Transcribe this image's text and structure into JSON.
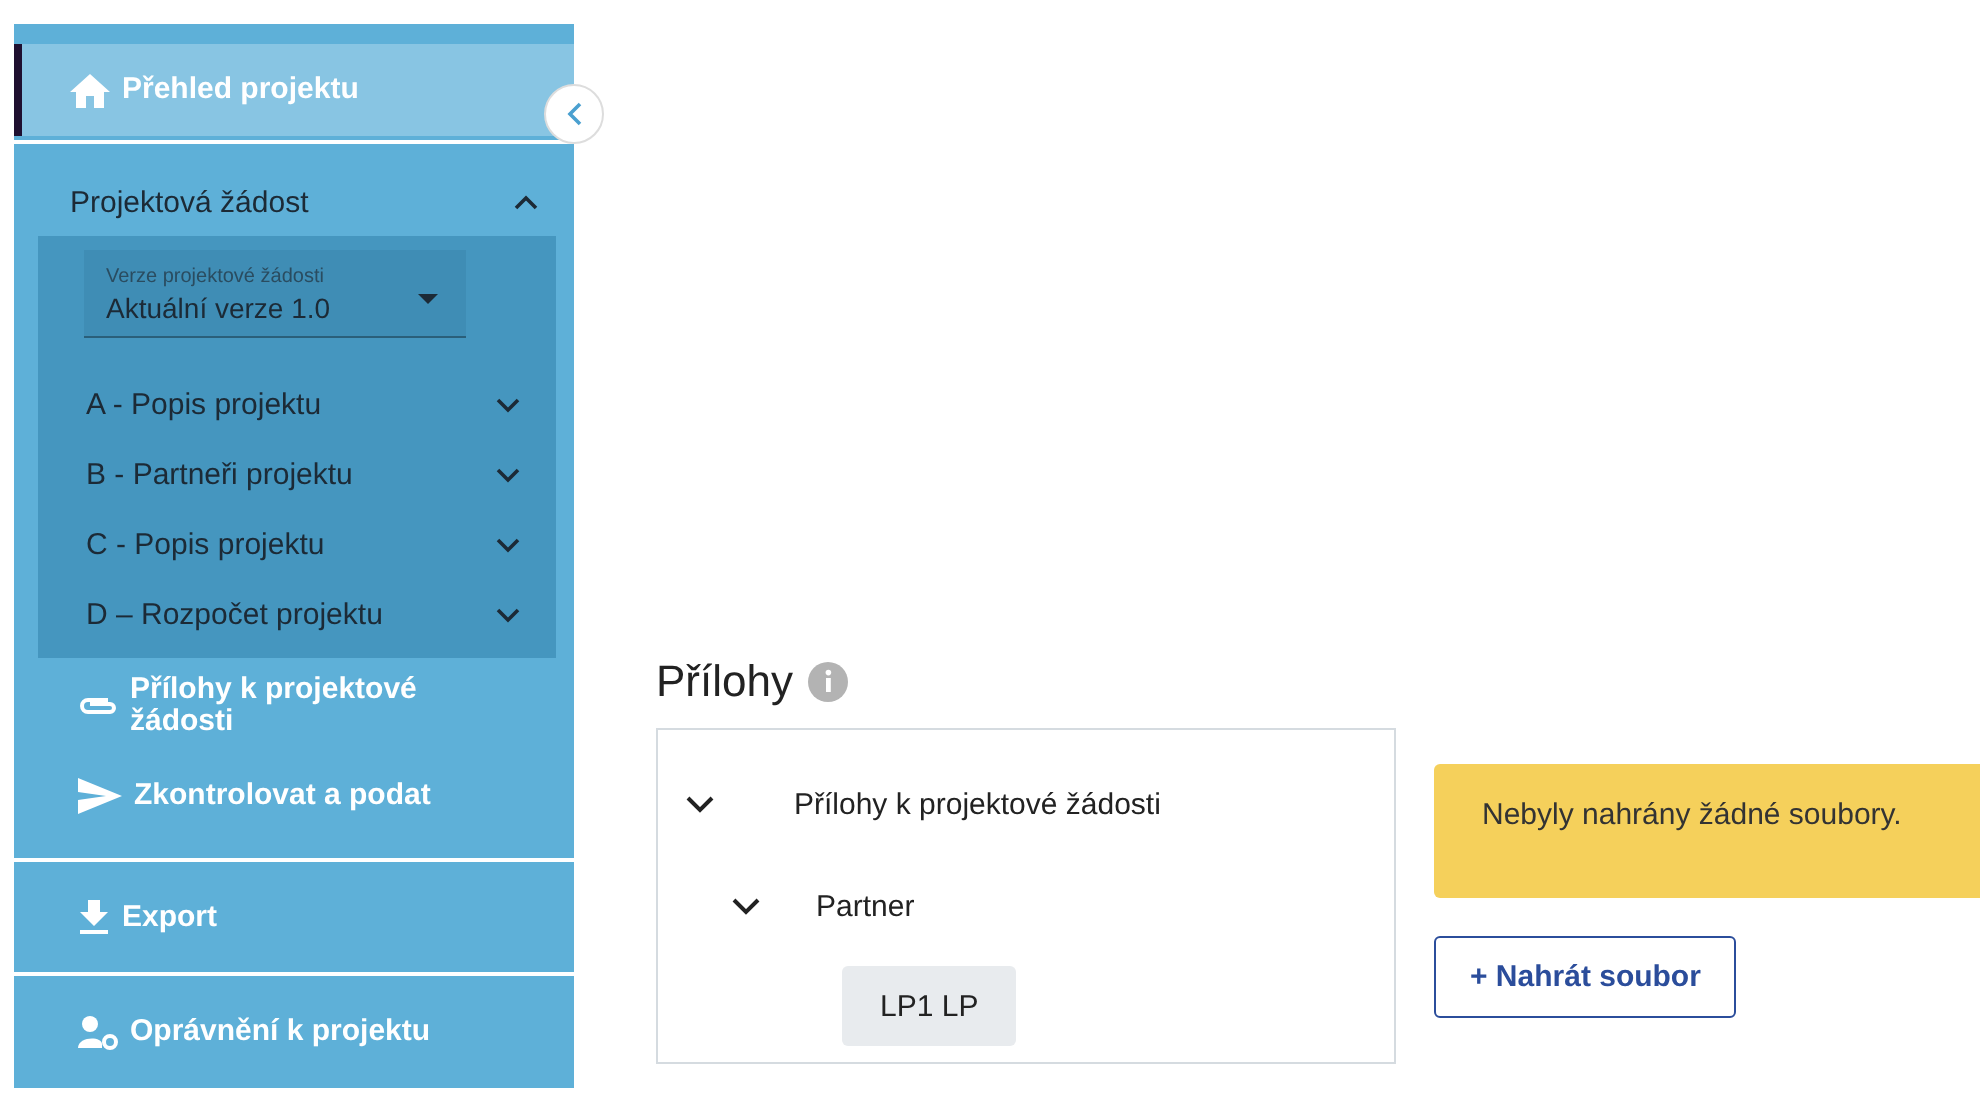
{
  "sidebar": {
    "items": [
      {
        "kind": "home",
        "label": "Přehled projektu",
        "selected": true
      },
      {
        "kind": "section",
        "label": "Projektová žádost",
        "expanded": true,
        "version_select": {
          "label": "Verze projektové žádosti",
          "value": "Aktuální verze 1.0"
        },
        "children": [
          {
            "label": "A - Popis projektu",
            "expanded": false
          },
          {
            "label": "B - Partneři projektu",
            "expanded": false
          },
          {
            "label": "C - Popis projektu",
            "expanded": false
          },
          {
            "label": "D – Rozpočet projektu",
            "expanded": false
          }
        ]
      },
      {
        "kind": "attachment",
        "label": "Přílohy k projektové žádosti",
        "selected": false
      },
      {
        "kind": "send",
        "label": "Zkontrolovat a podat",
        "selected": false
      },
      {
        "kind": "export",
        "label": "Export",
        "selected": false
      },
      {
        "kind": "permissions",
        "label": "Oprávnění k projektu",
        "selected": false
      }
    ]
  },
  "attachments": {
    "title": "Přílohy",
    "tree": [
      {
        "label": "Přílohy k projektové žádosti",
        "expanded": true,
        "children": [
          {
            "label": "Partner",
            "expanded": true,
            "children": [
              {
                "label": "LP1 LP",
                "selected": true
              }
            ]
          }
        ]
      }
    ],
    "alert": "Nebyly nahrány žádné soubory.",
    "upload_button": "+ Nahrát soubor"
  }
}
